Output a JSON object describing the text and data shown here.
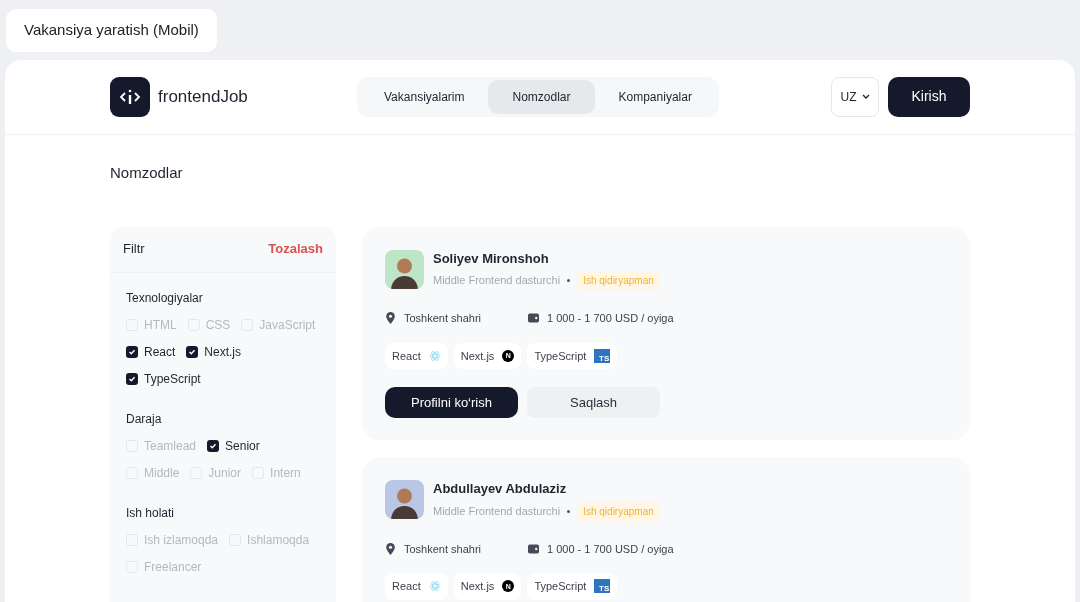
{
  "page_label": "Vakansiya yaratish (Mobil)",
  "header": {
    "logo_text": "frontendJob",
    "nav": [
      {
        "label": "Vakansiyalarim",
        "selected": false
      },
      {
        "label": "Nomzodlar",
        "selected": true
      },
      {
        "label": "Kompaniyalar",
        "selected": false
      }
    ],
    "language": "UZ",
    "login_button": "Kirish"
  },
  "heading": "Nomzodlar",
  "filter": {
    "title": "Filtr",
    "clear": "Tozalash",
    "groups": [
      {
        "title": "Texnologiyalar",
        "rows": [
          [
            {
              "label": "HTML",
              "checked": false
            },
            {
              "label": "CSS",
              "checked": false
            },
            {
              "label": "JavaScript",
              "checked": false
            }
          ],
          [
            {
              "label": "React",
              "checked": true
            },
            {
              "label": "Next.js",
              "checked": true
            }
          ],
          [
            {
              "label": "TypeScript",
              "checked": true
            }
          ]
        ]
      },
      {
        "title": "Daraja",
        "rows": [
          [
            {
              "label": "Teamlead",
              "checked": false
            },
            {
              "label": "Senior",
              "checked": true
            }
          ],
          [
            {
              "label": "Middle",
              "checked": false
            },
            {
              "label": "Junior",
              "checked": false
            },
            {
              "label": "Intern",
              "checked": false
            }
          ]
        ]
      },
      {
        "title": "Ish holati",
        "rows": [
          [
            {
              "label": "Ish izlamoqda",
              "checked": false
            },
            {
              "label": "Ishlamoqda",
              "checked": false
            }
          ],
          [
            {
              "label": "Freelancer",
              "checked": false
            }
          ]
        ]
      }
    ]
  },
  "candidates": [
    {
      "name": "Soliyev Mironshoh",
      "role": "Middle Frontend dasturchi",
      "status": "Ish qidiryapman",
      "location": "Toshkent shahri",
      "salary": "1 000 - 1 700 USD / oyiga",
      "color": "#bfe5c8",
      "tags": [
        {
          "label": "React",
          "kind": "react"
        },
        {
          "label": "Next.js",
          "kind": "next",
          "icon_text": "N"
        },
        {
          "label": "TypeScript",
          "kind": "typescript",
          "icon_text": "TS"
        }
      ],
      "buttons": {
        "primary": "Profilni ko‘rish",
        "secondary": "Saqlash"
      }
    },
    {
      "name": "Abdullayev Abdulaziz",
      "role": "Middle Frontend dasturchi",
      "status": "Ish qidiryapman",
      "location": "Toshkent shahri",
      "salary": "1 000 - 1 700 USD / oyiga",
      "color": "#b9c6e6",
      "tags": [
        {
          "label": "React",
          "kind": "react"
        },
        {
          "label": "Next.js",
          "kind": "next",
          "icon_text": "N"
        },
        {
          "label": "TypeScript",
          "kind": "typescript",
          "icon_text": "TS"
        }
      ]
    }
  ]
}
